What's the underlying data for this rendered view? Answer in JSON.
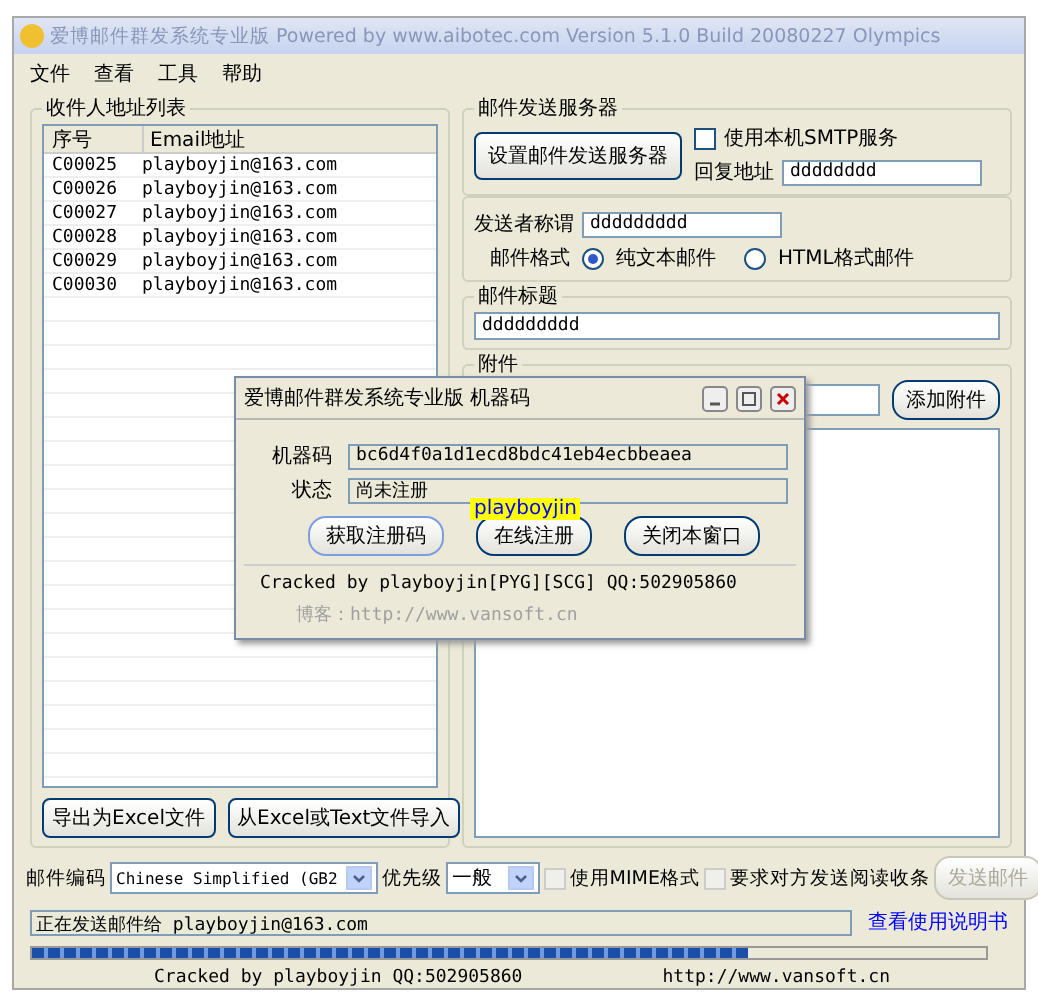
{
  "window": {
    "title": "爱博邮件群发系统专业版 Powered by www.aibotec.com Version 5.1.0 Build 20080227 Olympics"
  },
  "menu": [
    "文件",
    "查看",
    "工具",
    "帮助"
  ],
  "recipients": {
    "title": "收件人地址列表",
    "columns": [
      "序号",
      "Email地址"
    ],
    "rows": [
      {
        "id": "C00025",
        "email": "playboyjin@163.com"
      },
      {
        "id": "C00026",
        "email": "playboyjin@163.com"
      },
      {
        "id": "C00027",
        "email": "playboyjin@163.com"
      },
      {
        "id": "C00028",
        "email": "playboyjin@163.com"
      },
      {
        "id": "C00029",
        "email": "playboyjin@163.com"
      },
      {
        "id": "C00030",
        "email": "playboyjin@163.com"
      }
    ],
    "buttons": [
      "导出为Excel文件",
      "从Excel或Text文件导入"
    ]
  },
  "server": {
    "title": "邮件发送服务器",
    "button": "设置邮件发送服务器",
    "use_local_smtp": {
      "label": "使用本机SMTP服务",
      "checked": false
    },
    "reply_label": "回复地址",
    "reply_value": "dddddddd"
  },
  "sender": {
    "label": "发送者称谓",
    "value": "ddddddddd",
    "format_label": "邮件格式",
    "formats": [
      {
        "label": "纯文本邮件",
        "selected": true
      },
      {
        "label": "HTML格式邮件",
        "selected": false
      }
    ]
  },
  "subject": {
    "title": "邮件标题",
    "value": "ddddddddd"
  },
  "attachment": {
    "title": "附件",
    "button": "添加附件"
  },
  "options": {
    "encoding_label": "邮件编码",
    "encoding": "Chinese Simplified (GB2",
    "priority_label": "优先级",
    "priority": "一般",
    "mime": {
      "label": "使用MIME格式",
      "checked": false
    },
    "receipt": {
      "label": "要求对方发送阅读收条",
      "checked": false
    },
    "send_button": {
      "label": "发送邮件",
      "disabled": true
    }
  },
  "status": {
    "text": "正在发送邮件给 playboyjin@163.com",
    "link": "查看使用说明书",
    "level": 0.75,
    "footer_left": "Cracked by playboyjin  QQ:502905860",
    "footer_right": "http://www.vansoft.cn"
  },
  "dialog": {
    "title": "爱博邮件群发系统专业版 机器码",
    "machine_label": "机器码",
    "machine_value": "bc6d4f0a1d1ecd8bdc41eb4ecbbeaea",
    "state_label": "状态",
    "state_value": "尚未注册",
    "buttons": [
      "获取注册码",
      "在线注册",
      "关闭本窗口"
    ],
    "tooltip": "playboyjin",
    "credit": "Cracked by playboyjin[PYG][SCG]   QQ:502905860",
    "blog": "博客：http://www.vansoft.cn"
  }
}
